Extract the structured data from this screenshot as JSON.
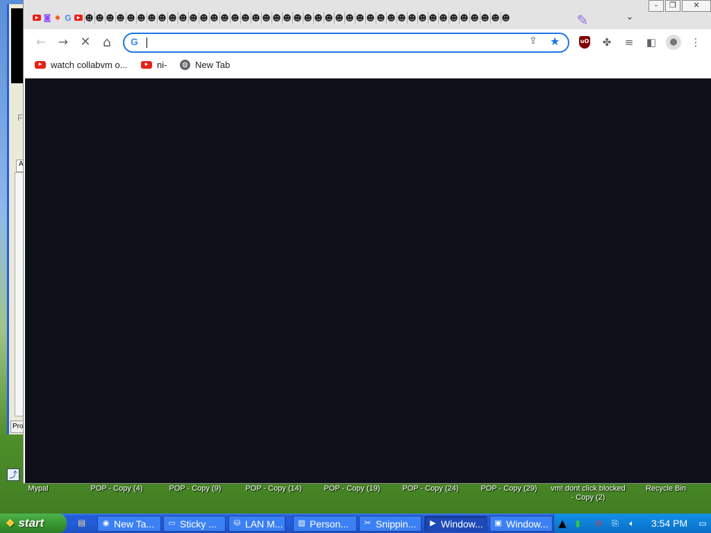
{
  "background_window": {
    "partial_text": "Fi",
    "tab_label": "A",
    "button_label": "Pro"
  },
  "browser": {
    "mini_tabs": [
      "youtube",
      "twitch",
      "brave",
      "google",
      "youtube",
      "skull",
      "skull",
      "skull",
      "skull",
      "skull",
      "skull",
      "skull",
      "skull",
      "skull",
      "skull",
      "skull",
      "skull",
      "skull",
      "skull",
      "skull",
      "skull",
      "skull",
      "skull",
      "skull",
      "skull",
      "skull",
      "skull",
      "skull",
      "skull",
      "skull",
      "skull",
      "skull",
      "skull",
      "skull",
      "skull",
      "skull",
      "skull",
      "skull",
      "skull",
      "skull",
      "skull",
      "skull",
      "skull",
      "skull",
      "skull",
      "skull"
    ],
    "omnibox": {
      "icon": "G",
      "value": ""
    },
    "bookmarks": [
      {
        "label": "watch collabvm o...",
        "icon": "youtube-icon"
      },
      {
        "label": "ni-",
        "icon": "youtube-icon"
      },
      {
        "label": "New Tab",
        "icon": "globe-icon"
      }
    ],
    "page_background": "#0f111a",
    "ublock_badge": "uO"
  },
  "desktop_icons": [
    "Mypal",
    "POP - Copy (4)",
    "POP - Copy (9)",
    "POP - Copy (14)",
    "POP - Copy (19)",
    "POP - Copy (24)",
    "POP - Copy (29)",
    "vm! dont click blocked - Copy (2)",
    "Recycle Bin"
  ],
  "taskbar": {
    "start_label": "start",
    "tasks": [
      {
        "label": "New Ta...",
        "icon": "chrome-icon",
        "active": false
      },
      {
        "label": "Sticky ...",
        "icon": "sticky-notes-icon",
        "active": false
      },
      {
        "label": "LAN M...",
        "icon": "lan-icon",
        "active": false
      },
      {
        "label": "Person...",
        "icon": "personalize-icon",
        "active": false
      },
      {
        "label": "Snippin...",
        "icon": "snipping-icon",
        "active": false
      },
      {
        "label": "Window...",
        "icon": "media-player-icon",
        "active": true
      },
      {
        "label": "Window...",
        "icon": "terminal-icon",
        "active": false
      }
    ],
    "clock": "3:54 PM"
  },
  "colors": {
    "accent": "#1a73e8",
    "taskbar": "#245edb",
    "start": "#36932d",
    "tray": "#0f7fd8"
  }
}
